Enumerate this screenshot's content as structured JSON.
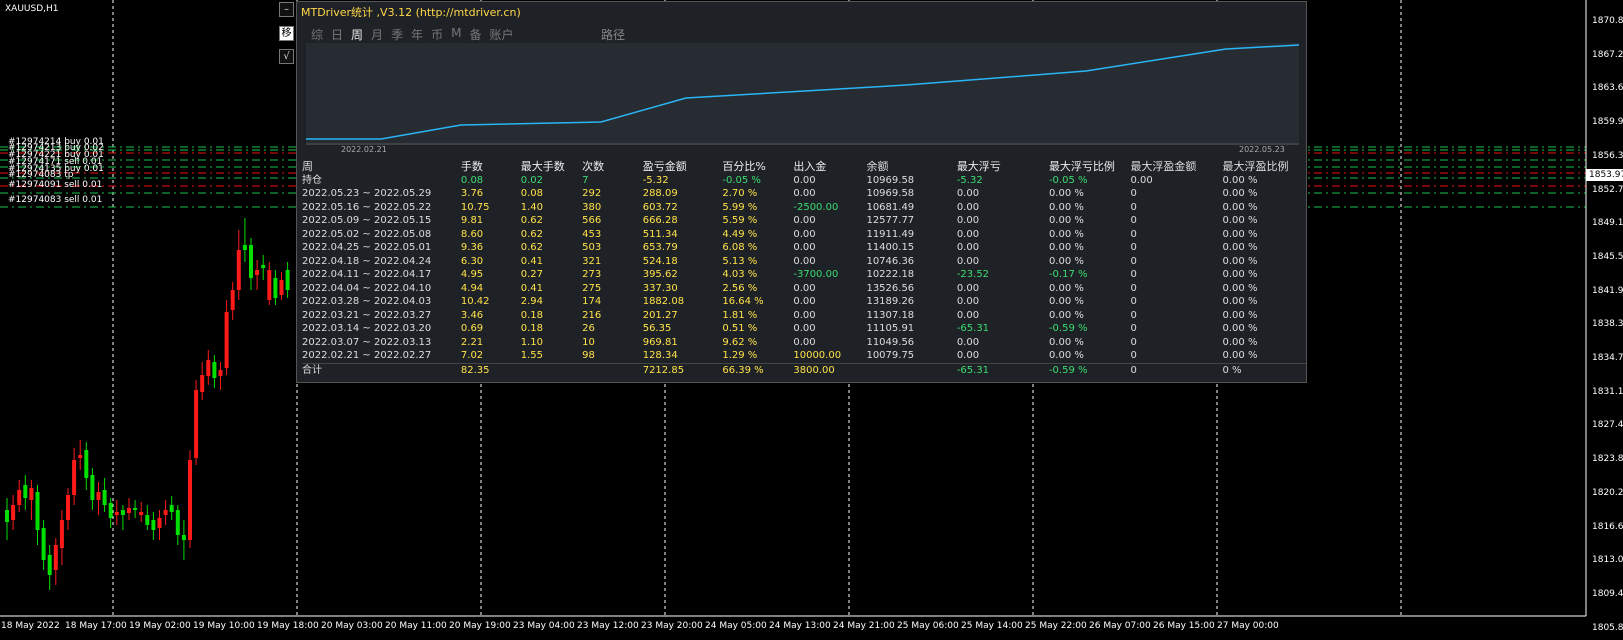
{
  "chart": {
    "symbol": "XAUUSD,H1",
    "price_ticks": [
      "1870.80",
      "1867.20",
      "1863.60",
      "1859.90",
      "1856.30",
      "1852.70",
      "1849.10",
      "1845.50",
      "1841.90",
      "1838.30",
      "1834.70",
      "1831.10",
      "1827.40",
      "1823.80",
      "1820.20",
      "1816.60",
      "1813.00",
      "1809.40",
      "1805.80"
    ],
    "current_price": "1853.97",
    "time_ticks": [
      "18 May 2022",
      "18 May 17:00",
      "19 May 02:00",
      "19 May 10:00",
      "19 May 18:00",
      "20 May 03:00",
      "20 May 11:00",
      "20 May 19:00",
      "23 May 04:00",
      "23 May 12:00",
      "23 May 20:00",
      "24 May 05:00",
      "24 May 13:00",
      "24 May 21:00",
      "25 May 06:00",
      "25 May 14:00",
      "25 May 22:00",
      "26 May 07:00",
      "26 May 15:00",
      "27 May 00:00"
    ],
    "order_labels": [
      "#12974214 buy 0.01",
      "#12974213 buy 0.02",
      "#12974221 buy 0.01",
      "#12974171 sell 0.01",
      "#12974135 buy 0.01",
      "#12974083 tp",
      "#12974091 sell 0.01",
      "#12974083 sell 0.01"
    ],
    "side_buttons": [
      "–",
      "移",
      "√"
    ],
    "colors": {
      "bull": "#00e000",
      "bear": "#ff1a1a",
      "grid": "#ffffff",
      "curve": "#29b6f6"
    }
  },
  "panel": {
    "title": "MTDriver统计 ,V3.12 (http://mtdriver.cn)",
    "tabs": [
      "综",
      "日",
      "周",
      "月",
      "季",
      "年",
      "币",
      "M",
      "备",
      "账户"
    ],
    "active_tab": "周",
    "path_label": "路径",
    "curve_start_date": "2022.02.21",
    "curve_end_date": "2022.05.23",
    "headers": [
      "周",
      "手数",
      "最大手数",
      "次数",
      "盈亏金额",
      "百分比%",
      "出入金",
      "余额",
      "最大浮亏",
      "最大浮亏比例",
      "最大浮盈金额",
      "最大浮盈比例"
    ],
    "rows": [
      [
        "持仓",
        "0.08",
        "0.02",
        "7",
        "-5.32",
        "-0.05 %",
        "0.00",
        "10969.58",
        "-5.32",
        "-0.05 %",
        "0.00",
        "0.00 %"
      ],
      [
        "2022.05.23 ~ 2022.05.29",
        "3.76",
        "0.08",
        "292",
        "288.09",
        "2.70 %",
        "0.00",
        "10969.58",
        "0.00",
        "0.00 %",
        "0",
        "0.00 %"
      ],
      [
        "2022.05.16 ~ 2022.05.22",
        "10.75",
        "1.40",
        "380",
        "603.72",
        "5.99 %",
        "-2500.00",
        "10681.49",
        "0.00",
        "0.00 %",
        "0",
        "0.00 %"
      ],
      [
        "2022.05.09 ~ 2022.05.15",
        "9.81",
        "0.62",
        "566",
        "666.28",
        "5.59 %",
        "0.00",
        "12577.77",
        "0.00",
        "0.00 %",
        "0",
        "0.00 %"
      ],
      [
        "2022.05.02 ~ 2022.05.08",
        "8.60",
        "0.62",
        "453",
        "511.34",
        "4.49 %",
        "0.00",
        "11911.49",
        "0.00",
        "0.00 %",
        "0",
        "0.00 %"
      ],
      [
        "2022.04.25 ~ 2022.05.01",
        "9.36",
        "0.62",
        "503",
        "653.79",
        "6.08 %",
        "0.00",
        "11400.15",
        "0.00",
        "0.00 %",
        "0",
        "0.00 %"
      ],
      [
        "2022.04.18 ~ 2022.04.24",
        "6.30",
        "0.41",
        "321",
        "524.18",
        "5.13 %",
        "0.00",
        "10746.36",
        "0.00",
        "0.00 %",
        "0",
        "0.00 %"
      ],
      [
        "2022.04.11 ~ 2022.04.17",
        "4.95",
        "0.27",
        "273",
        "395.62",
        "4.03 %",
        "-3700.00",
        "10222.18",
        "-23.52",
        "-0.17 %",
        "0",
        "0.00 %"
      ],
      [
        "2022.04.04 ~ 2022.04.10",
        "4.94",
        "0.41",
        "275",
        "337.30",
        "2.56 %",
        "0.00",
        "13526.56",
        "0.00",
        "0.00 %",
        "0",
        "0.00 %"
      ],
      [
        "2022.03.28 ~ 2022.04.03",
        "10.42",
        "2.94",
        "174",
        "1882.08",
        "16.64 %",
        "0.00",
        "13189.26",
        "0.00",
        "0.00 %",
        "0",
        "0.00 %"
      ],
      [
        "2022.03.21 ~ 2022.03.27",
        "3.46",
        "0.18",
        "216",
        "201.27",
        "1.81 %",
        "0.00",
        "11307.18",
        "0.00",
        "0.00 %",
        "0",
        "0.00 %"
      ],
      [
        "2022.03.14 ~ 2022.03.20",
        "0.69",
        "0.18",
        "26",
        "56.35",
        "0.51 %",
        "0.00",
        "11105.91",
        "-65.31",
        "-0.59 %",
        "0",
        "0.00 %"
      ],
      [
        "2022.03.07 ~ 2022.03.13",
        "2.21",
        "1.10",
        "10",
        "969.81",
        "9.62 %",
        "0.00",
        "11049.56",
        "0.00",
        "0.00 %",
        "0",
        "0.00 %"
      ],
      [
        "2022.02.21 ~ 2022.02.27",
        "7.02",
        "1.55",
        "98",
        "128.34",
        "1.29 %",
        "10000.00",
        "10079.75",
        "0.00",
        "0.00 %",
        "0",
        "0.00 %"
      ]
    ],
    "total": [
      "合计",
      "82.35",
      "",
      "",
      "7212.85",
      "66.39 %",
      "3800.00",
      "",
      "-65.31",
      "-0.59 %",
      "0",
      "0 %"
    ]
  }
}
